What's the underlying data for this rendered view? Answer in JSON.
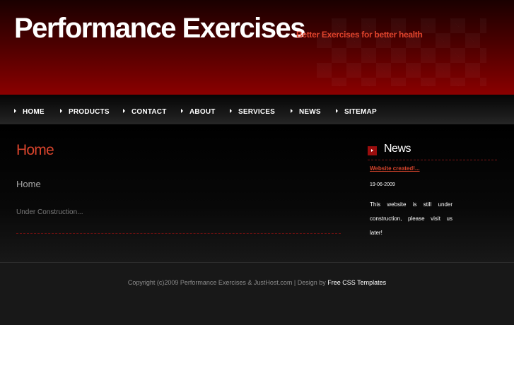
{
  "header": {
    "title": "Performance Exercises",
    "slogan": "Better Exercises for better health"
  },
  "menu": {
    "items": [
      {
        "label": "HOME"
      },
      {
        "label": "PRODUCTS"
      },
      {
        "label": "CONTACT"
      },
      {
        "label": "ABOUT"
      },
      {
        "label": "SERVICES"
      },
      {
        "label": "NEWS"
      },
      {
        "label": "SITEMAP"
      }
    ]
  },
  "main": {
    "page_heading": "Home",
    "sub_heading": "Home",
    "body": "Under Construction..."
  },
  "sidebar": {
    "news_title": "News",
    "post": {
      "link": "Website created!...",
      "date": "19-06-2009",
      "text": "This website is still under construction, please visit us later!"
    }
  },
  "footer": {
    "copyright": "Copyright (c)2009 Performance Exercises & JustHost.com | Design by",
    "design_link": "Free CSS Templates"
  },
  "colors": {
    "brand_red": "#8a0000",
    "accent": "#d8442c",
    "background": "#000000"
  },
  "icons": [
    "menu-bullet-icon",
    "news-arrow-icon"
  ]
}
